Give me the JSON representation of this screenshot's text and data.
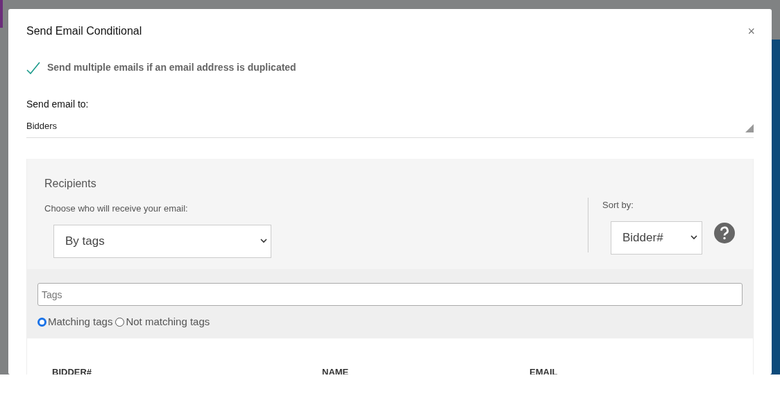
{
  "dialog": {
    "title": "Send Email Conditional",
    "close": "×"
  },
  "duplicate_option": {
    "label": "Send multiple emails if an email address is duplicated",
    "checked": true
  },
  "send_to": {
    "label": "Send email to:",
    "value": "Bidders"
  },
  "recipients": {
    "heading": "Recipients",
    "choose_label": "Choose who will receive your email:",
    "choose_value": "By tags",
    "sort_label": "Sort by:",
    "sort_value": "Bidder#"
  },
  "tags": {
    "placeholder": "Tags"
  },
  "tag_match": [
    {
      "label": "Matching tags",
      "selected": true
    },
    {
      "label": "Not matching tags",
      "selected": false
    }
  ],
  "table": {
    "columns": [
      "BIDDER#",
      "NAME",
      "EMAIL"
    ]
  }
}
